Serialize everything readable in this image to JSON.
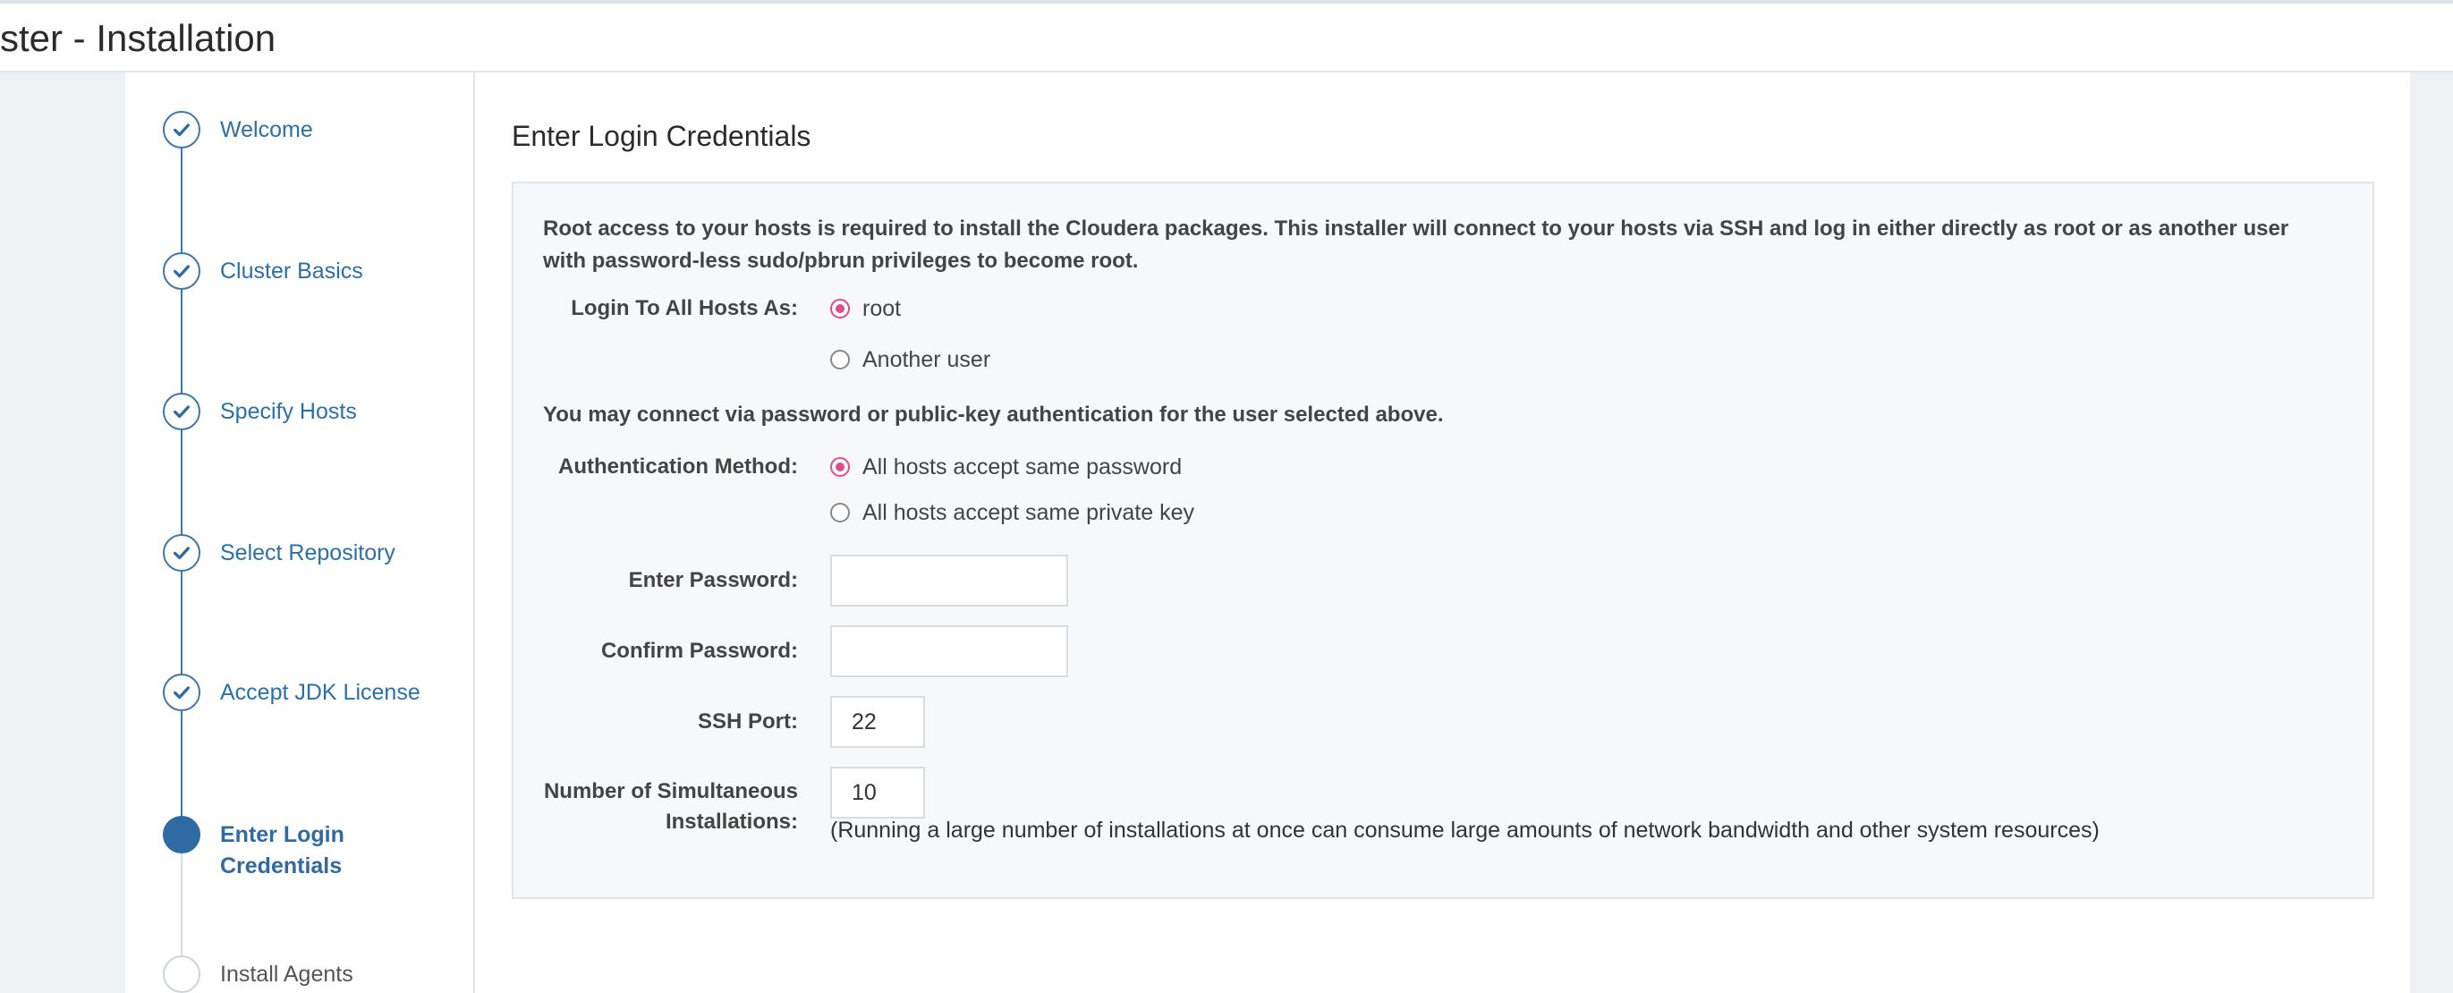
{
  "header": {
    "title": "ster - Installation"
  },
  "steps": [
    {
      "label": "Welcome",
      "state": "done"
    },
    {
      "label": "Cluster Basics",
      "state": "done"
    },
    {
      "label": "Specify Hosts",
      "state": "done"
    },
    {
      "label": "Select Repository",
      "state": "done"
    },
    {
      "label": "Accept JDK License",
      "state": "done"
    },
    {
      "label_line1": "Enter Login",
      "label_line2": "Credentials",
      "state": "current"
    },
    {
      "label": "Install Agents",
      "state": "pending"
    }
  ],
  "page": {
    "title": "Enter Login Credentials",
    "intro": "Root access to your hosts is required to install the Cloudera packages. This installer will connect to your hosts via SSH and log in either directly as root or as another user with password-less sudo/pbrun privileges to become root.",
    "login": {
      "label": "Login To All Hosts As:",
      "options": [
        "root",
        "Another user"
      ],
      "selected": "root"
    },
    "auth_intro": "You may connect via password or public-key authentication for the user selected above.",
    "auth": {
      "label": "Authentication Method:",
      "options": [
        "All hosts accept same password",
        "All hosts accept same private key"
      ],
      "selected": "All hosts accept same password"
    },
    "password": {
      "label": "Enter Password:",
      "value": ""
    },
    "confirm_password": {
      "label": "Confirm Password:",
      "value": ""
    },
    "ssh_port": {
      "label": "SSH Port:",
      "value": "22"
    },
    "simultaneous": {
      "label_line1": "Number of Simultaneous",
      "label_line2": "Installations:",
      "value": "10",
      "note": "(Running a large number of installations at once can consume large amounts of network bandwidth and other system resources)"
    }
  },
  "colors": {
    "accent": "#2f6aa3",
    "radio_checked": "#e04b8f"
  },
  "icons": {
    "step_done": "check-icon"
  }
}
